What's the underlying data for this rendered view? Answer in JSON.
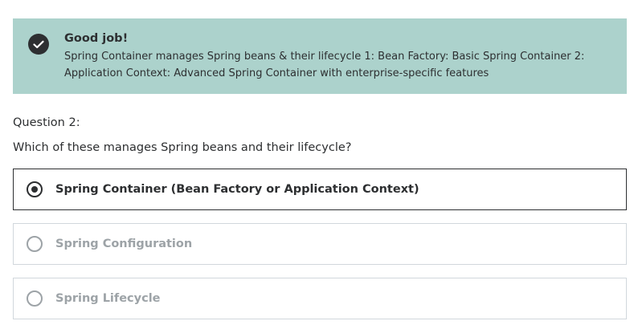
{
  "alert": {
    "icon": "check-circle-icon",
    "title": "Good job!",
    "body": "Spring Container manages Spring beans & their lifecycle 1: Bean Factory: Basic Spring Container 2: Application Context: Advanced Spring Container with enterprise-specific features",
    "background": "#acd2cc"
  },
  "question": {
    "number": "Question 2:",
    "text": "Which of these manages Spring beans and their lifecycle?"
  },
  "options": [
    {
      "label": "Spring Container (Bean Factory or Application Context)",
      "selected": true
    },
    {
      "label": "Spring Configuration",
      "selected": false
    },
    {
      "label": "Spring Lifecycle",
      "selected": false
    }
  ]
}
